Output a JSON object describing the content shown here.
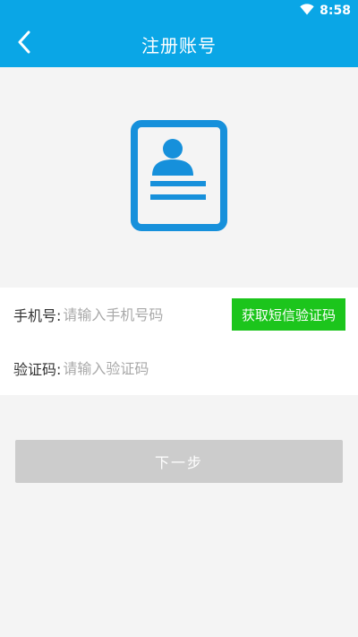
{
  "status_bar": {
    "time": "8:58",
    "icons": [
      "wifi-icon"
    ]
  },
  "header": {
    "title": "注册账号",
    "back_icon": "back-arrow-icon"
  },
  "hero": {
    "icon": "id-card-icon",
    "accent_color": "#1690db"
  },
  "form": {
    "phone": {
      "label": "手机号:",
      "placeholder": "请输入手机号码",
      "value": ""
    },
    "sms_button_label": "获取短信验证码",
    "code": {
      "label": "验证码:",
      "placeholder": "请输入验证码",
      "value": ""
    }
  },
  "next_button_label": "下一步",
  "colors": {
    "header": "#0aa6e6",
    "sms_button": "#1cc51c",
    "next_button_disabled": "#cccccc",
    "background": "#f4f4f4"
  }
}
